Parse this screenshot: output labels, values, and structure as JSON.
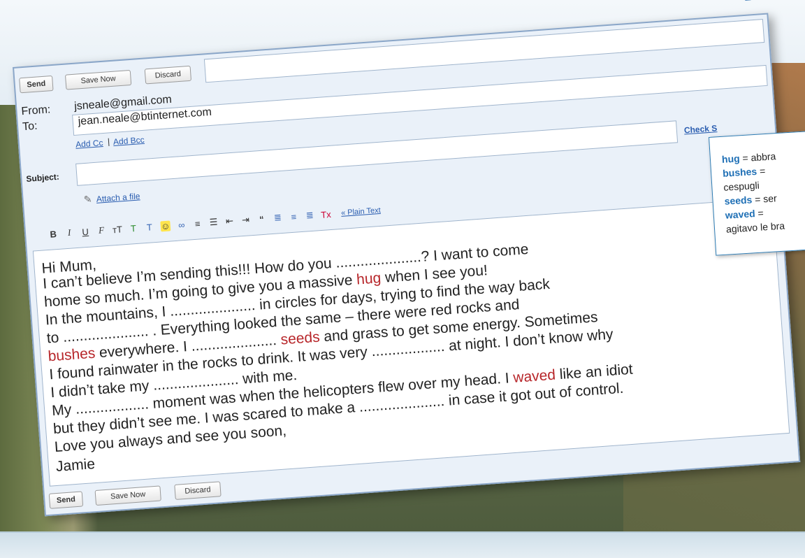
{
  "buttons": {
    "send": "Send",
    "save_now": "Save Now",
    "discard": "Discard"
  },
  "from": {
    "label": "From:",
    "value": "jsneale@gmail.com"
  },
  "to": {
    "label": "To:",
    "value": "jean.neale@btinternet.com"
  },
  "links": {
    "add_cc": "Add Cc",
    "separator": "|",
    "add_bcc": "Add Bcc",
    "attach": "Attach a file",
    "check_spelling": "Check S",
    "plain_text": "« Plain Text"
  },
  "subject": {
    "label": "Subject:",
    "value": ""
  },
  "toolbar_icons": [
    "bold-icon",
    "italic-icon",
    "underline-icon",
    "font-icon",
    "font-size-icon",
    "text-color-icon",
    "highlight-icon",
    "emoticon-icon",
    "link-icon",
    "numbered-list-icon",
    "bulleted-list-icon",
    "indent-less-icon",
    "indent-more-icon",
    "quote-icon",
    "align-left-icon",
    "align-center-icon",
    "align-right-icon",
    "remove-formatting-icon"
  ],
  "body_lines": [
    {
      "a": "Hi Mum,",
      "r": "",
      "b": ""
    },
    {
      "a": "I can’t believe I’m sending this!!! How do you .....................? I want to come",
      "r": "",
      "b": ""
    },
    {
      "a": "home so much. I’m going to give you a massive ",
      "r": "hug",
      "b": " when I see you!"
    },
    {
      "a": "In the mountains, I ..................... in circles for days, trying to find the way back",
      "r": "",
      "b": ""
    },
    {
      "a": "to ..................... . Everything looked the same – there were red rocks and",
      "r": "",
      "b": ""
    },
    {
      "a": "",
      "r": "bushes",
      "b": " everywhere. I ..................... seeds and grass to get some energy. Sometimes"
    },
    {
      "a": "I found rainwater in the rocks to drink. It was very .................. at night. I don’t know why",
      "r": "",
      "b": ""
    },
    {
      "a": "I didn’t take my ..................... with me.",
      "r": "",
      "b": ""
    },
    {
      "a": "My .................. moment was when the helicopters flew over my head. I ",
      "r": "waved",
      "b": " like an idiot"
    },
    {
      "a": "but they didn’t see me. I was scared to make a ..................... in case it got out of control.",
      "r": "",
      "b": ""
    },
    {
      "a": "Love you always and see you soon,",
      "r": "",
      "b": ""
    },
    {
      "a": "Jamie",
      "r": "",
      "b": ""
    }
  ],
  "vocab": [
    {
      "term": "hug",
      "eq": " = ",
      "trans": "abbra"
    },
    {
      "term": "bushes",
      "eq": " = ",
      "trans": ""
    },
    {
      "term": "",
      "eq": "",
      "trans": "cespugli"
    },
    {
      "term": "seeds",
      "eq": " = ",
      "trans": "ser"
    },
    {
      "term": "waved",
      "eq": " = ",
      "trans": ""
    },
    {
      "term": "",
      "eq": "",
      "trans": "agitavo le bra"
    }
  ],
  "colors": {
    "highlight_red": "#b7262a",
    "vocab_blue": "#1e6fb5",
    "link_blue": "#2a5db0"
  }
}
